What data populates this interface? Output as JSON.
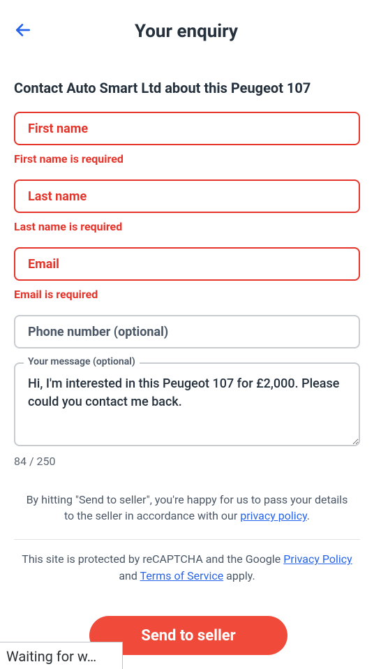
{
  "header": {
    "title": "Your enquiry"
  },
  "subtitle": "Contact Auto Smart Ltd about this Peugeot 107",
  "fields": {
    "first_name": {
      "placeholder": "First name",
      "error": "First name is required"
    },
    "last_name": {
      "placeholder": "Last name",
      "error": "Last name is required"
    },
    "email": {
      "placeholder": "Email",
      "error": "Email is required"
    },
    "phone": {
      "placeholder": "Phone number (optional)"
    },
    "message": {
      "label": "Your message (optional)",
      "value": "Hi, I'm interested in this Peugeot 107 for £2,000. Please could you contact me back.",
      "counter": "84 / 250"
    }
  },
  "notice": {
    "line1a": "By hitting \"Send to seller\", you're happy for us to pass your details to the seller in accordance with our ",
    "privacy_link": "privacy policy",
    "line2a": "This site is protected by reCAPTCHA and the Google ",
    "g_privacy": "Privacy Policy",
    "line2b": " and ",
    "g_tos": "Terms of Service",
    "line2c": " apply."
  },
  "send_label": "Send to seller",
  "status_text": "Waiting for w…"
}
